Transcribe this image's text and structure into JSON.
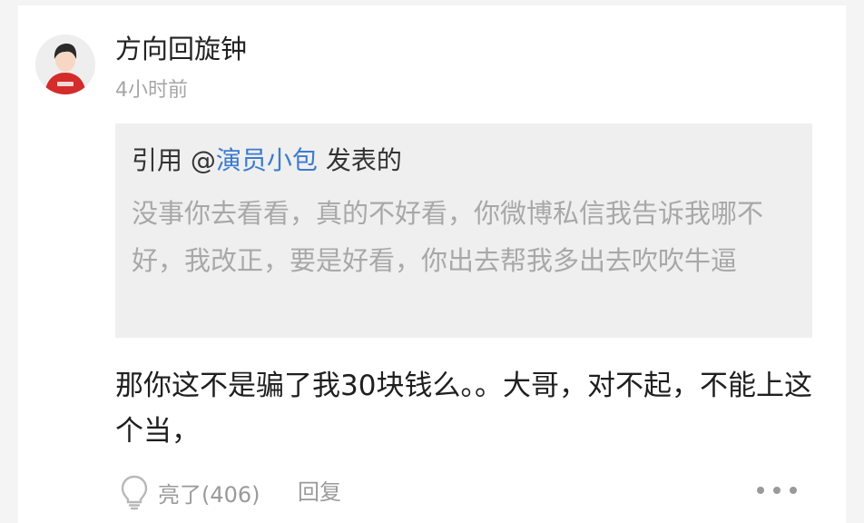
{
  "comment": {
    "username": "方向回旋钟",
    "timestamp": "4小时前",
    "quote": {
      "prefix": "引用 @",
      "author": "演员小包",
      "suffix": " 发表的",
      "text": "没事你去看看，真的不好看，你微博私信我告诉我哪不好，我改正，要是好看，你出去帮我多出去吹吹牛逼"
    },
    "text": "那你这不是骗了我30块钱么。。大哥，对不起，不能上这个当，",
    "actions": {
      "like_label": "亮了(406)",
      "reply_label": "回复",
      "like_icon": "lightbulb-icon",
      "more_icon": "more-dots-icon"
    }
  },
  "colors": {
    "background": "#f4f4f4",
    "card": "#ffffff",
    "quote_background": "#efefef",
    "author_link": "#3b7bd0",
    "muted_text": "#a8a8a8",
    "avatar_shirt": "#d42b2b"
  }
}
